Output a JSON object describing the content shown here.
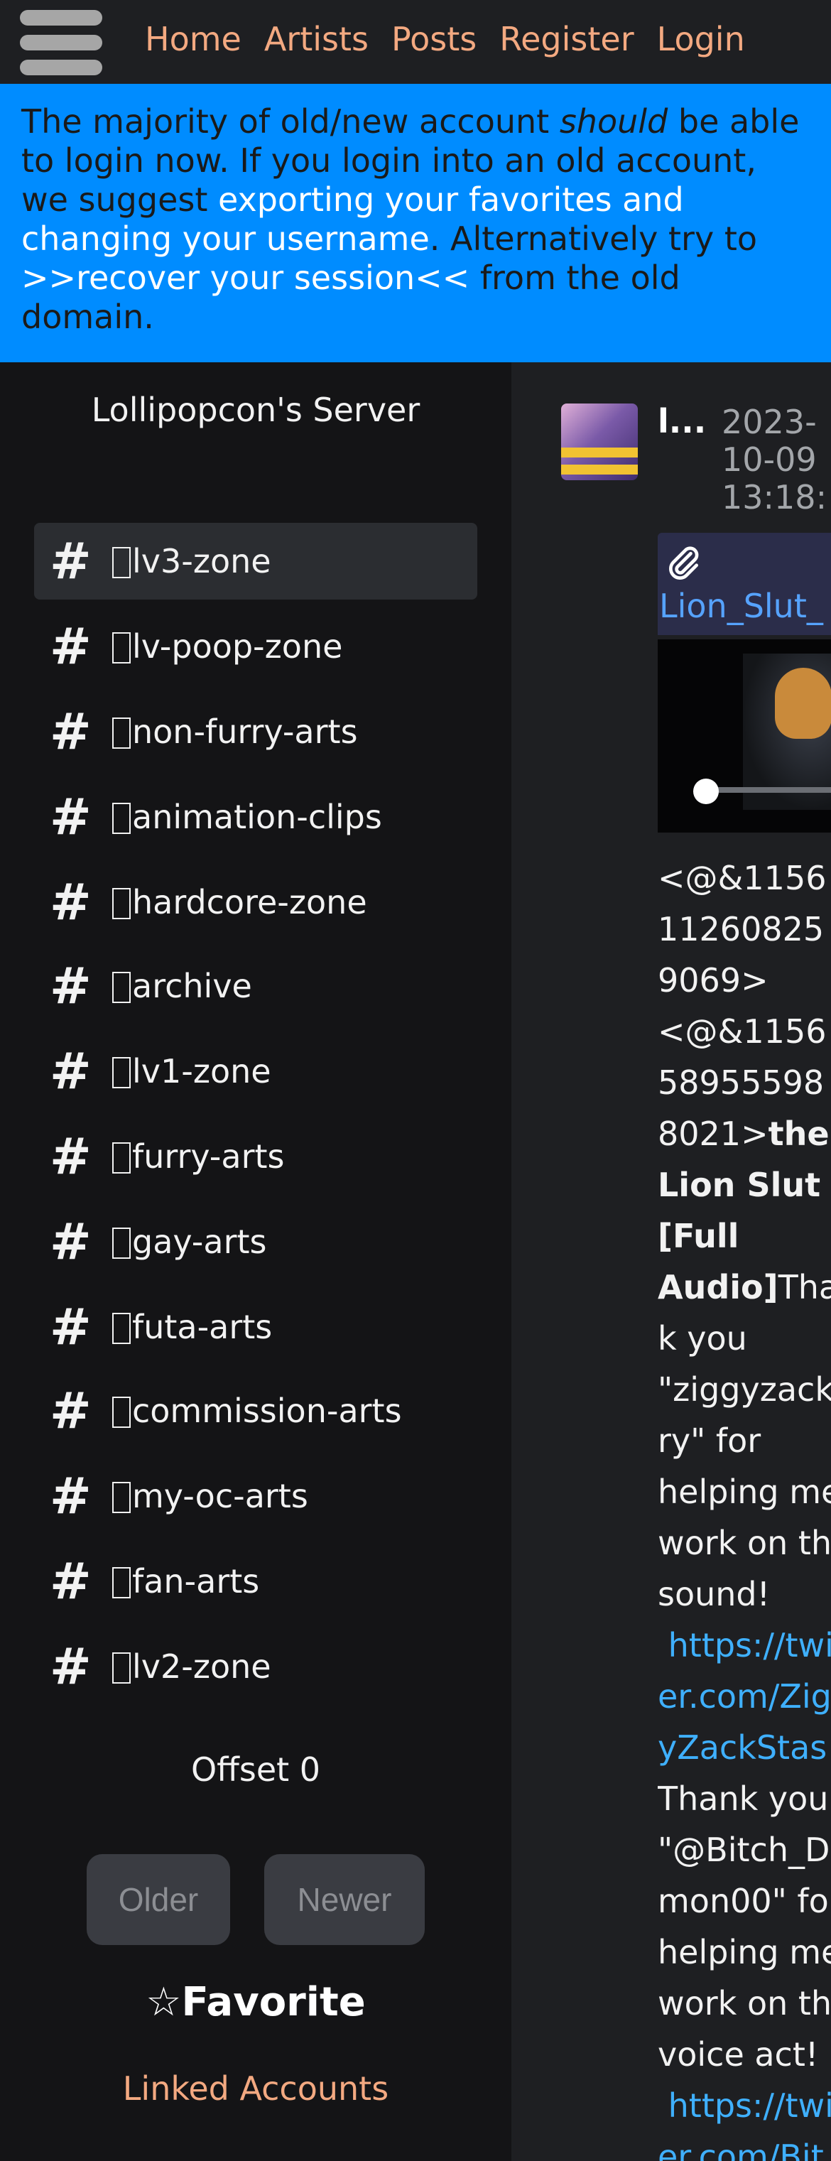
{
  "nav": {
    "links": [
      "Home",
      "Artists",
      "Posts",
      "Register",
      "Login"
    ]
  },
  "banner": {
    "part1": "The majority of old/new account ",
    "emphasis": "should",
    "part2": " be able to login now. If you login into an old account, we suggest ",
    "link1": "exporting your favorites and changing your username",
    "part3": ". Alternatively try to ",
    "link2": ">>recover your session<<",
    "part4": " from the old domain."
  },
  "sidebar": {
    "server_name": "Lollipopcon's Server",
    "channels": [
      "lv3-zone",
      "lv-poop-zone",
      "non-furry-arts",
      "animation-clips",
      "hardcore-zone",
      "archive",
      "lv1-zone",
      "furry-arts",
      "gay-arts",
      "futa-arts",
      "commission-arts",
      "my-oc-arts",
      "fan-arts",
      "lv2-zone"
    ],
    "hash_symbol": "#",
    "offset_label": "Offset 0",
    "older_label": "Older",
    "newer_label": "Newer",
    "favorite_star": "☆",
    "favorite_label": "Favorite",
    "linked_accounts_label": "Linked Accounts"
  },
  "message": {
    "author": "l...",
    "timestamp": "2023-\n10-09\n13:18:",
    "attachment_name": "Lion_Slut_",
    "content": {
      "l1": "<@&1156",
      "l2": "11260825",
      "l3": "9069>",
      "l4": "<@&1156",
      "l5": "58955598",
      "l6a": "8021>",
      "l6b": "the",
      "l7": "Lion Slut",
      "l8": "[Full",
      "l9a": "Audio]",
      "l9b": "Tha",
      "l10": "k you",
      "l11": "\"ziggyzack",
      "l12": "ry\" for",
      "l13": "helping me",
      "l14": "work on th",
      "l15": "sound!",
      "l16": " https://twi",
      "l17": "er.com/Zig",
      "l18": "yZackStas",
      "l19": "Thank you",
      "l20": "\"@Bitch_D",
      "l21": "mon00\" fo",
      "l22": "helping me",
      "l23": "work on th",
      "l24": "voice act!",
      "l25": " https://twi",
      "l26": "er.com/Bit"
    }
  },
  "colors": {
    "nav_link": "#f3a981",
    "banner_bg": "#008cff",
    "sidebar_bg": "#141416",
    "active_channel_bg": "#2b2d31",
    "link_blue": "#3fb0ff"
  }
}
